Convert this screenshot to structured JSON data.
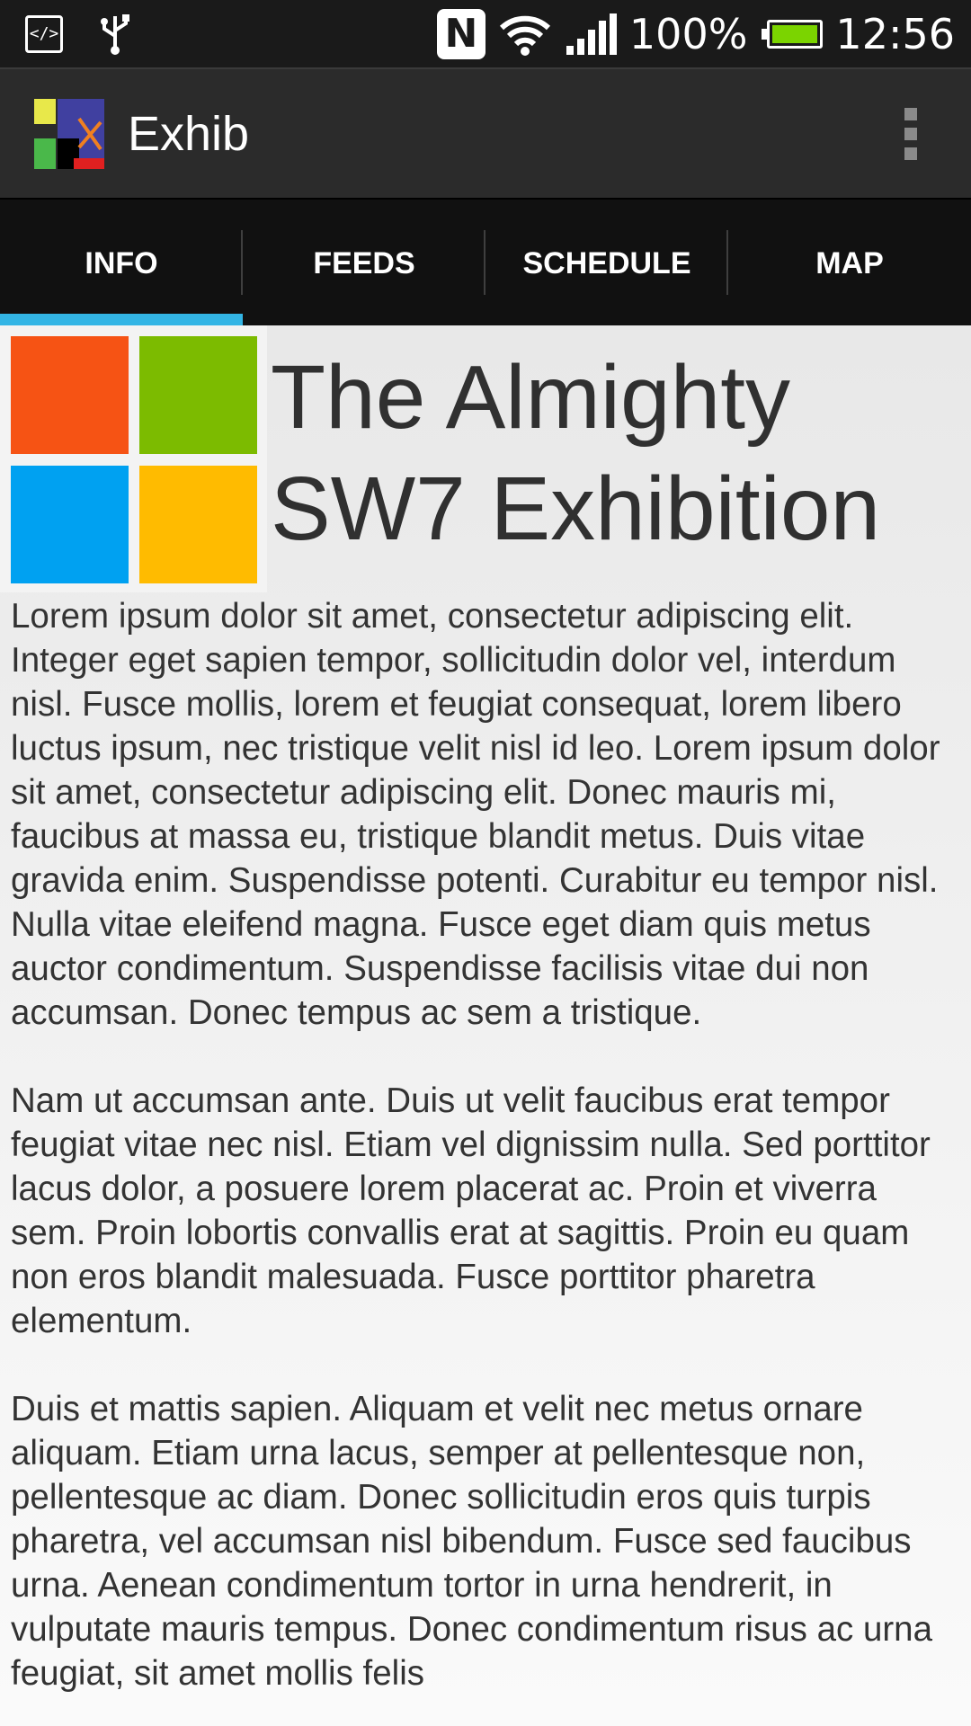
{
  "status_bar": {
    "battery_percent": "100%",
    "time": "12:56",
    "icons": [
      "developer-icon",
      "usb-icon",
      "nfc-icon",
      "wifi-icon",
      "signal-icon",
      "battery-icon"
    ],
    "battery_color": "#7bd400"
  },
  "action_bar": {
    "app_title": "Exhib",
    "overflow_icon": "more-vert-icon"
  },
  "tabs": [
    {
      "label": "INFO",
      "selected": true
    },
    {
      "label": "FEEDS",
      "selected": false
    },
    {
      "label": "SCHEDULE",
      "selected": false
    },
    {
      "label": "MAP",
      "selected": false
    }
  ],
  "colors": {
    "tab_indicator": "#33b5e5",
    "logo_orange": "#f65314",
    "logo_green": "#7cbb00",
    "logo_blue": "#00a1f1",
    "logo_yellow": "#ffbb00"
  },
  "content": {
    "title": "The Almighty SW7 Exhibition",
    "paragraphs": [
      "Lorem ipsum dolor sit amet, consectetur adipiscing elit. Integer eget sapien tempor, sollicitudin dolor vel, interdum nisl. Fusce mollis, lorem et feugiat consequat, lorem libero luctus ipsum, nec tristique velit nisl id leo. Lorem ipsum dolor sit amet, consectetur adipiscing elit. Donec mauris mi, faucibus at massa eu, tristique blandit metus. Duis vitae gravida enim. Suspendisse potenti. Curabitur eu tempor nisl. Nulla vitae eleifend magna. Fusce eget diam quis metus auctor condimentum. Suspendisse facilisis vitae dui non accumsan. Donec tempus ac sem a tristique.",
      "Nam ut accumsan ante. Duis ut velit faucibus erat tempor feugiat vitae nec nisl. Etiam vel dignissim nulla. Sed porttitor lacus dolor, a posuere lorem placerat ac. Proin et viverra sem. Proin lobortis convallis erat at sagittis. Proin eu quam non eros blandit malesuada. Fusce porttitor pharetra elementum.",
      "Duis et mattis sapien. Aliquam et velit nec metus ornare aliquam. Etiam urna lacus, semper at pellentesque non, pellentesque ac diam. Donec sollicitudin eros quis turpis pharetra, vel accumsan nisl bibendum. Fusce sed faucibus urna. Aenean condimentum tortor in urna hendrerit, in vulputate mauris tempus. Donec condimentum risus ac urna feugiat, sit amet mollis felis"
    ]
  }
}
